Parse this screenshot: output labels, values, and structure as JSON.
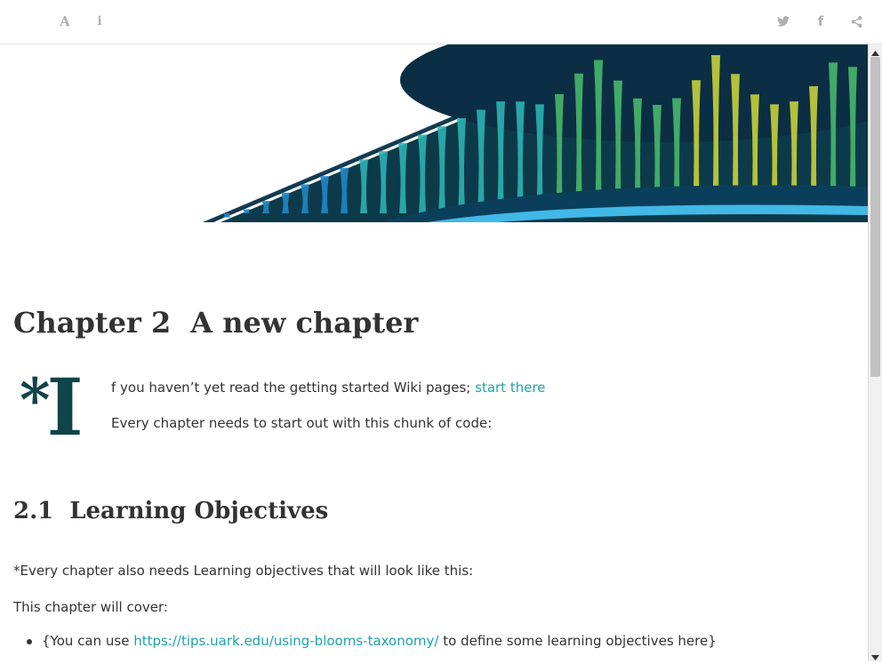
{
  "toolbar": {
    "left_buttons": [
      {
        "icon": "font-settings-icon",
        "glyph": "A"
      },
      {
        "icon": "info-icon",
        "glyph": "i"
      }
    ],
    "right_buttons": [
      {
        "icon": "twitter-icon"
      },
      {
        "icon": "facebook-icon",
        "glyph": "f"
      },
      {
        "icon": "share-icon"
      }
    ]
  },
  "banner": {
    "colors": {
      "dark": "#0d3a4a",
      "navy": "#0b2e44",
      "blue": "#1e88c8",
      "teal": "#2bb3b1",
      "green": "#47b86a",
      "lime": "#c7d23a",
      "light": "#42b8e6"
    }
  },
  "chapter": {
    "number": "Chapter 2",
    "title": "A new chapter"
  },
  "dropcap": {
    "asterisk": "*",
    "letter": "I",
    "color": "#0f4449"
  },
  "intro": {
    "line1_text": "f you haven’t yet read the getting started Wiki pages; ",
    "line1_link": "start there",
    "line2_text": "Every chapter needs to start out with this chunk of code:"
  },
  "section": {
    "number": "2.1",
    "title": "Learning Objectives"
  },
  "body": {
    "p1": "*Every chapter also needs Learning objectives that will look like this:",
    "p2": "This chapter will cover:",
    "bullet1_before": "{You can use ",
    "bullet1_link": "https://tips.uark.edu/using-blooms-taxonomy/",
    "bullet1_after": " to define some learning objectives here}"
  },
  "colors": {
    "link": "#20a3a8",
    "text": "#333333",
    "toolbar_icon": "#b0b0b0"
  }
}
